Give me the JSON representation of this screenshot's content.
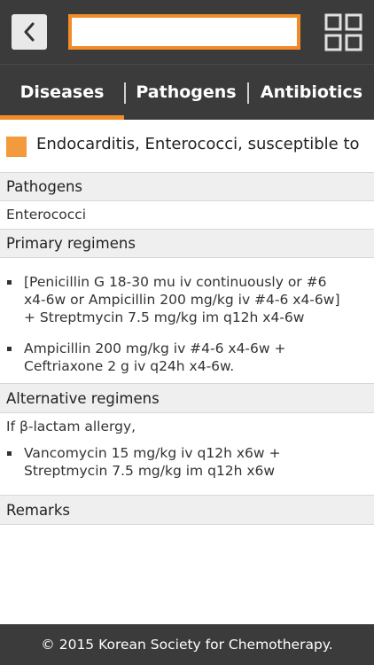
{
  "header": {
    "back_icon": "chevron-left-icon",
    "search_value": "",
    "menu_icon": "grid-icon",
    "accent_color": "#f28c28"
  },
  "tabs": [
    {
      "label": "Diseases",
      "active": true
    },
    {
      "label": "Pathogens",
      "active": false
    },
    {
      "label": "Antibiotics",
      "active": false
    }
  ],
  "title": "Endocarditis, Enterococci, susceptible to ...",
  "sections": {
    "pathogens": {
      "header": "Pathogens",
      "text": "Enterococci"
    },
    "primary": {
      "header": "Primary regimens",
      "items": [
        "[Penicillin G 18-30 mu iv continuously or #6 x4-6w or Ampicillin 200 mg/kg iv #4-6 x4-6w] + Streptmycin 7.5 mg/kg im q12h x4-6w",
        "Ampicillin 200 mg/kg iv #4-6 x4-6w + Ceftriaxone 2 g iv q24h x4-6w."
      ]
    },
    "alternative": {
      "header": "Alternative regimens",
      "note": "If β-lactam allergy,",
      "items": [
        "Vancomycin 15 mg/kg iv q12h x6w + Streptmycin 7.5 mg/kg im q12h x6w"
      ]
    },
    "remarks": {
      "header": "Remarks"
    }
  },
  "footer": "© 2015 Korean Society for Chemotherapy."
}
